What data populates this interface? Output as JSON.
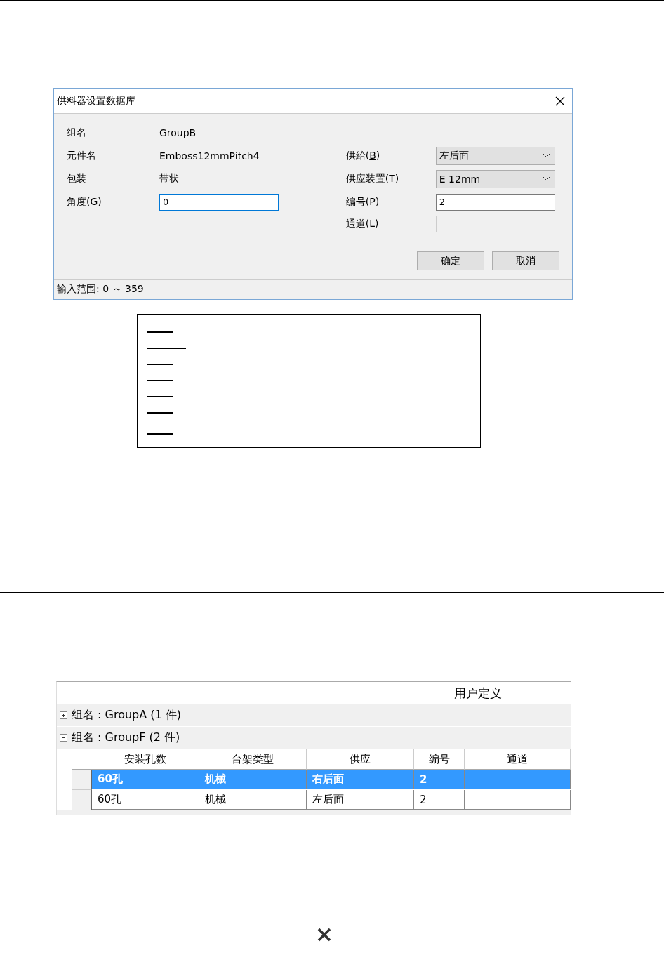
{
  "dialog": {
    "title": "供料器设置数据库",
    "left_fields": [
      {
        "label": "组名",
        "kind": "text",
        "value": "GroupB"
      },
      {
        "label": "元件名",
        "kind": "text",
        "value": "Emboss12mmPitch4"
      },
      {
        "label": "包装",
        "kind": "text",
        "value": "带状"
      },
      {
        "label": "角度(",
        "key": "G",
        "after": ")",
        "kind": "input",
        "value": "0",
        "focused": true
      }
    ],
    "right_fields": [
      {
        "label": "供給(",
        "key": "B",
        "after": ")",
        "kind": "dropdown",
        "value": "左后面"
      },
      {
        "label": "供应装置(",
        "key": "T",
        "after": ")",
        "kind": "dropdown",
        "value": "E 12mm"
      },
      {
        "label": "编号(",
        "key": "P",
        "after": ")",
        "kind": "input",
        "value": "2"
      },
      {
        "label": "通道(",
        "key": "L",
        "after": ")",
        "kind": "disabled"
      }
    ],
    "buttons": [
      "确定",
      "取消"
    ],
    "status": "输入范围: 0 ～ 359"
  },
  "grid": {
    "header": "用户定义",
    "groups": [
      {
        "label": "组名 : GroupA (1 件)",
        "expanded": false
      },
      {
        "label": "组名 : GroupF (2 件)",
        "expanded": true,
        "columns": [
          "安装孔数",
          "台架类型",
          "供应",
          "编号",
          "通道"
        ],
        "rows": [
          {
            "cells": [
              "60孔",
              "机械",
              "右后面",
              "2",
              ""
            ],
            "selected": true
          },
          {
            "cells": [
              "60孔",
              "机械",
              "左后面",
              "2",
              ""
            ],
            "selected": false
          }
        ]
      }
    ]
  }
}
